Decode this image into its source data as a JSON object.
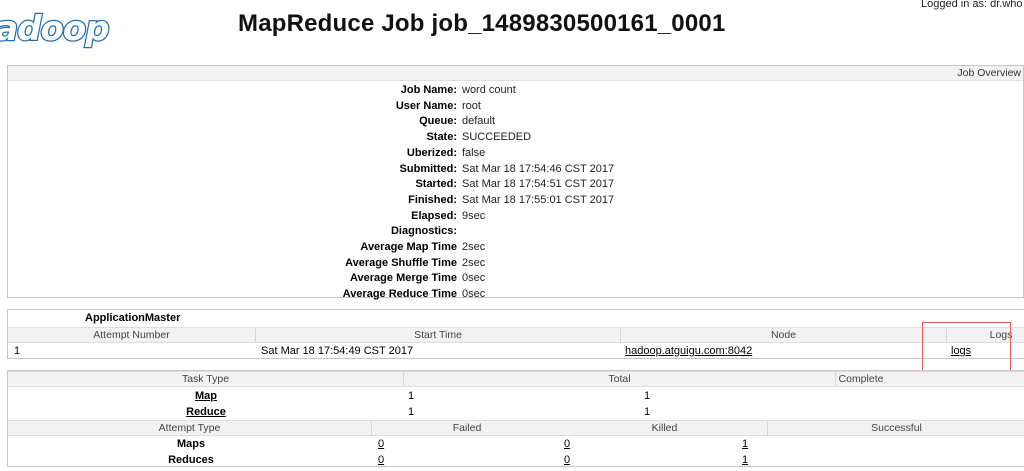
{
  "header": {
    "logo_text": "hadoop",
    "title": "MapReduce Job job_1489830500161_0001",
    "login_info": "Logged in as: dr.who"
  },
  "overview": {
    "section_label": "Job Overview",
    "rows": [
      {
        "key": "Job Name:",
        "value": "word count"
      },
      {
        "key": "User Name:",
        "value": "root"
      },
      {
        "key": "Queue:",
        "value": "default"
      },
      {
        "key": "State:",
        "value": "SUCCEEDED"
      },
      {
        "key": "Uberized:",
        "value": "false"
      },
      {
        "key": "Submitted:",
        "value": "Sat Mar 18 17:54:46 CST 2017"
      },
      {
        "key": "Started:",
        "value": "Sat Mar 18 17:54:51 CST 2017"
      },
      {
        "key": "Finished:",
        "value": "Sat Mar 18 17:55:01 CST 2017"
      },
      {
        "key": "Elapsed:",
        "value": "9sec"
      },
      {
        "key": "Diagnostics:",
        "value": ""
      },
      {
        "key": "Average Map Time",
        "value": "2sec"
      },
      {
        "key": "Average Shuffle Time",
        "value": "2sec"
      },
      {
        "key": "Average Merge Time",
        "value": "0sec"
      },
      {
        "key": "Average Reduce Time",
        "value": "0sec"
      }
    ]
  },
  "application_master": {
    "title": "ApplicationMaster",
    "columns": [
      "Attempt Number",
      "Start Time",
      "Node",
      "Logs"
    ],
    "row": {
      "attempt": "1",
      "start_time": "Sat Mar 18 17:54:49 CST 2017",
      "node": "hadoop.atguigu.com:8042",
      "logs": "logs"
    }
  },
  "tasks": {
    "columns": [
      "Task Type",
      "Total",
      "Complete"
    ],
    "rows": [
      {
        "type": "Map",
        "total": "1",
        "complete": "1"
      },
      {
        "type": "Reduce",
        "total": "1",
        "complete": "1"
      }
    ]
  },
  "attempts": {
    "columns": [
      "Attempt Type",
      "Failed",
      "Killed",
      "Successful"
    ],
    "rows": [
      {
        "type": "Maps",
        "failed": "0",
        "killed": "0",
        "successful": "1"
      },
      {
        "type": "Reduces",
        "failed": "0",
        "killed": "0",
        "successful": "1"
      }
    ]
  },
  "colors": {
    "logo_blue": "#1d6fb5",
    "highlight_red": "#e35c5c",
    "header_bg": "#f2f2f2"
  }
}
